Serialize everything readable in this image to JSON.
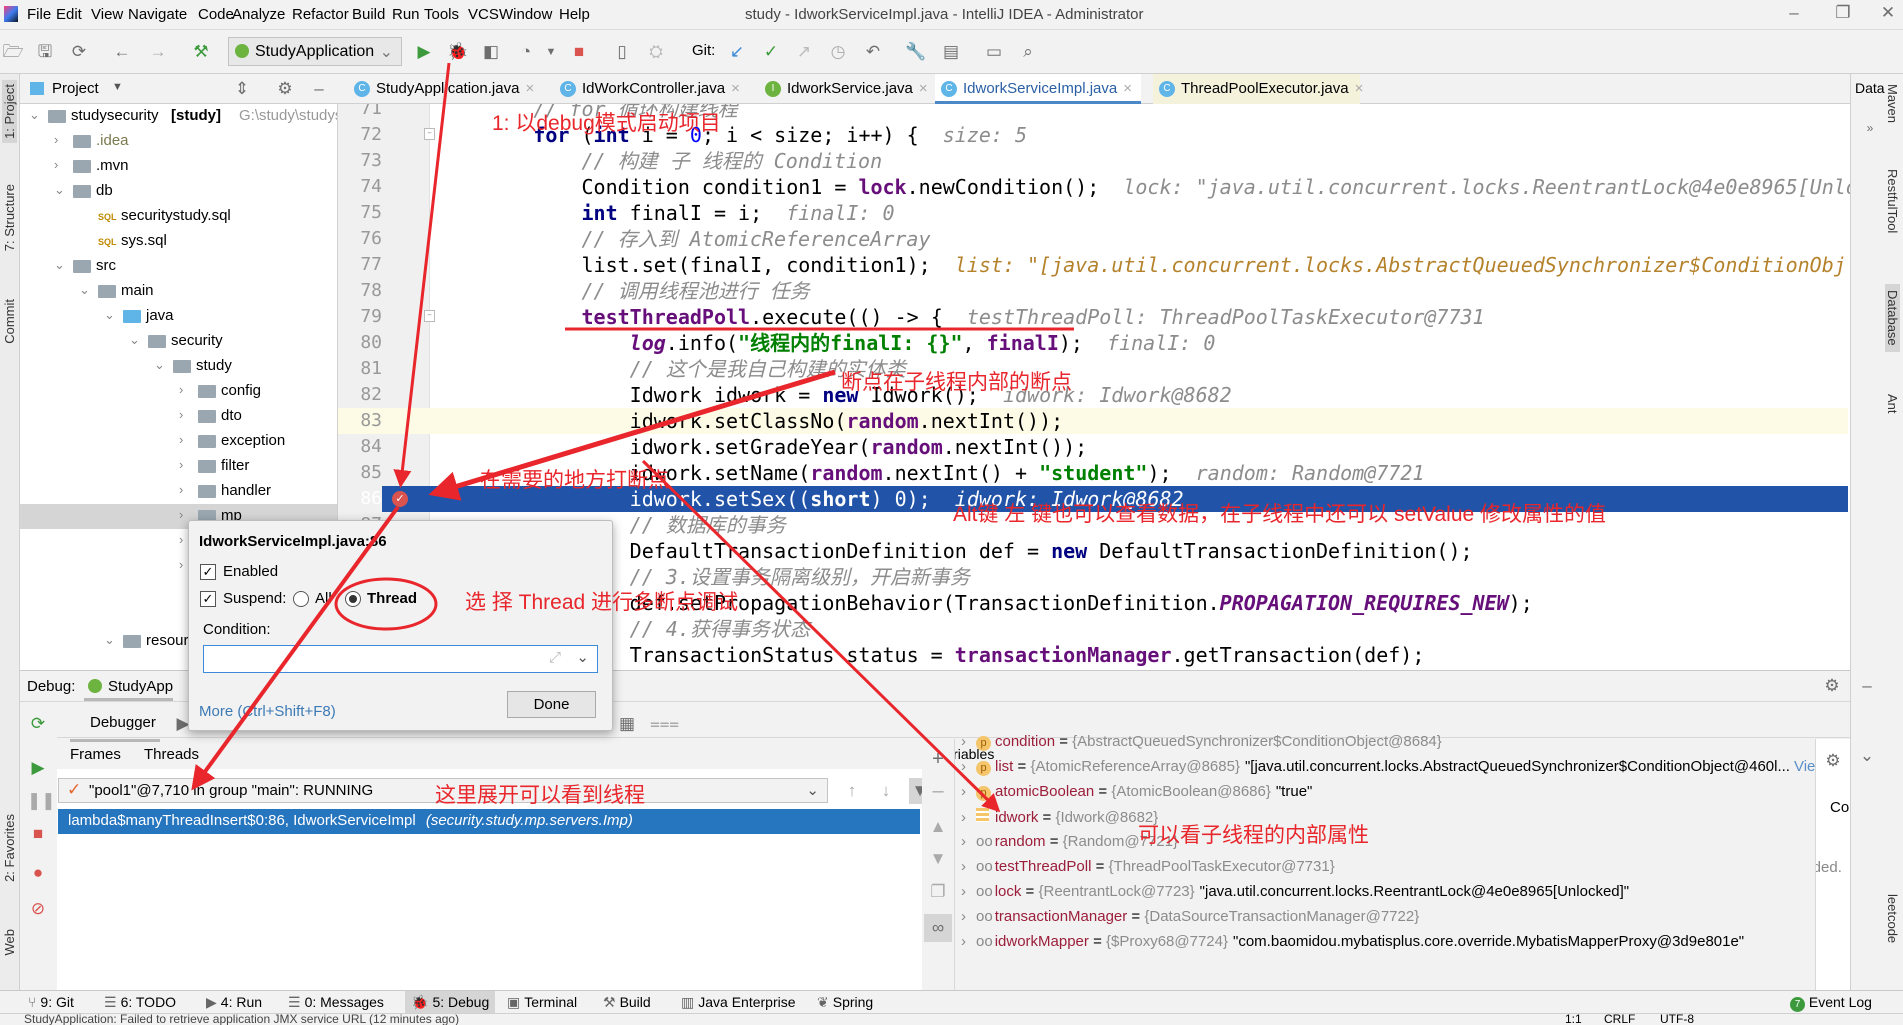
{
  "window": {
    "title": "study - IdworkServiceImpl.java - IntelliJ IDEA - Administrator",
    "menu": [
      "File",
      "Edit",
      "View",
      "Navigate",
      "Code",
      "Analyze",
      "Refactor",
      "Build",
      "Run",
      "Tools",
      "VCS",
      "Window",
      "Help"
    ]
  },
  "toolbar": {
    "run_config": "StudyApplication",
    "git_label": "Git:"
  },
  "left_strip": [
    "1: Project",
    "7: Structure",
    "Commit",
    "2: Favorites",
    "Web"
  ],
  "right_strip": [
    "Maven",
    "RestfulTool",
    "Database",
    "Ant"
  ],
  "right_panel_label": "Data",
  "project": {
    "header": "Project",
    "tree": [
      {
        "label": "studysecurity",
        "bold": "[study]",
        "path": "G:\\study\\studysec",
        "level": 0,
        "arrow": "down",
        "icon": "module"
      },
      {
        "label": ".idea",
        "level": 1,
        "arrow": "right",
        "icon": "folder"
      },
      {
        "label": ".mvn",
        "level": 1,
        "arrow": "right",
        "icon": "folder"
      },
      {
        "label": "db",
        "level": 1,
        "arrow": "down",
        "icon": "folder"
      },
      {
        "label": "securitystudy.sql",
        "level": 2,
        "arrow": "",
        "icon": "sql"
      },
      {
        "label": "sys.sql",
        "level": 2,
        "arrow": "",
        "icon": "sql"
      },
      {
        "label": "src",
        "level": 1,
        "arrow": "down",
        "icon": "folder"
      },
      {
        "label": "main",
        "level": 2,
        "arrow": "down",
        "icon": "folder"
      },
      {
        "label": "java",
        "level": 3,
        "arrow": "down",
        "icon": "java-folder"
      },
      {
        "label": "security",
        "level": 4,
        "arrow": "down",
        "icon": "package"
      },
      {
        "label": "study",
        "level": 5,
        "arrow": "down",
        "icon": "package"
      },
      {
        "label": "config",
        "level": 6,
        "arrow": "right",
        "icon": "package"
      },
      {
        "label": "dto",
        "level": 6,
        "arrow": "right",
        "icon": "package"
      },
      {
        "label": "exception",
        "level": 6,
        "arrow": "right",
        "icon": "package"
      },
      {
        "label": "filter",
        "level": 6,
        "arrow": "right",
        "icon": "package"
      },
      {
        "label": "handler",
        "level": 6,
        "arrow": "right",
        "icon": "package"
      },
      {
        "label": "mp",
        "level": 6,
        "arrow": "right",
        "icon": "package",
        "selected": true
      },
      {
        "label": "",
        "level": 6,
        "arrow": "right",
        "icon": ""
      },
      {
        "label": "",
        "level": 6,
        "arrow": "right",
        "icon": ""
      },
      {
        "label": "",
        "level": 6,
        "arrow": "",
        "icon": ""
      },
      {
        "label": "",
        "level": 6,
        "arrow": "",
        "icon": ""
      },
      {
        "label": "resour",
        "level": 3,
        "arrow": "down",
        "icon": "folder"
      }
    ]
  },
  "tabs": [
    {
      "label": "StudyApplication.java",
      "icon": "C"
    },
    {
      "label": "IdWorkController.java",
      "icon": "C"
    },
    {
      "label": "IdworkService.java",
      "icon": "I"
    },
    {
      "label": "IdworkServiceImpl.java",
      "icon": "C",
      "active": true
    },
    {
      "label": "ThreadPoolExecutor.java",
      "icon": "C"
    }
  ],
  "editor": {
    "current_line": 83,
    "selected_line": 86,
    "breakpoint_line": 86,
    "lines": [
      {
        "n": "71",
        "t": [
          [
            "p",
            "        "
          ],
          [
            "cm",
            "// for 循环构建线程"
          ]
        ]
      },
      {
        "n": "72",
        "t": [
          [
            "p",
            "        "
          ],
          [
            "kw",
            "for"
          ],
          [
            "p",
            " ("
          ],
          [
            "kw",
            "int"
          ],
          [
            "p",
            " i = "
          ],
          [
            "num",
            "0"
          ],
          [
            "p",
            "; i < size; i++) {"
          ],
          [
            "hint",
            "  size: 5"
          ]
        ]
      },
      {
        "n": "73",
        "t": [
          [
            "p",
            "            "
          ],
          [
            "cm",
            "// 构建 子 线程的 Condition"
          ]
        ]
      },
      {
        "n": "74",
        "t": [
          [
            "p",
            "            Condition condition1 = "
          ],
          [
            "fld",
            "lock"
          ],
          [
            "p",
            ".newCondition();"
          ],
          [
            "hint",
            "  lock: \"java.util.concurrent.locks.ReentrantLock@4e0e8965[Unlocked]\""
          ]
        ]
      },
      {
        "n": "75",
        "t": [
          [
            "p",
            "            "
          ],
          [
            "kw",
            "int"
          ],
          [
            "p",
            " finalI = i;"
          ],
          [
            "hint",
            "  finalI: 0"
          ]
        ]
      },
      {
        "n": "76",
        "t": [
          [
            "p",
            "            "
          ],
          [
            "cm",
            "// 存入到 AtomicReferenceArray"
          ]
        ]
      },
      {
        "n": "77",
        "t": [
          [
            "p",
            "            list.set(finalI, condition1);"
          ],
          [
            "hintstr",
            "  list: \"[java.util.concurrent.locks.AbstractQueuedSynchronizer$ConditionObj"
          ]
        ]
      },
      {
        "n": "78",
        "t": [
          [
            "p",
            "            "
          ],
          [
            "cm",
            "// 调用线程池进行 任务"
          ]
        ]
      },
      {
        "n": "79",
        "t": [
          [
            "p",
            "            "
          ],
          [
            "fld",
            "testThreadPoll"
          ],
          [
            "p",
            ".execute(() -> {"
          ],
          [
            "hint",
            "  testThreadPoll: ThreadPoolTaskExecutor@7731"
          ]
        ]
      },
      {
        "n": "80",
        "t": [
          [
            "p",
            "                "
          ],
          [
            "fldi",
            "log"
          ],
          [
            "p",
            ".info("
          ],
          [
            "str",
            "\"线程内的finalI: {}\""
          ],
          [
            "p",
            ", "
          ],
          [
            "fld",
            "finalI"
          ],
          [
            "p",
            ");"
          ],
          [
            "hint",
            "  finalI: 0"
          ]
        ]
      },
      {
        "n": "81",
        "t": [
          [
            "p",
            "                "
          ],
          [
            "cm",
            "// 这个是我自己构建的实体类"
          ]
        ]
      },
      {
        "n": "82",
        "t": [
          [
            "p",
            "                Idwork idwork = "
          ],
          [
            "kw",
            "new"
          ],
          [
            "p",
            " Idwork();"
          ],
          [
            "hint",
            "  idwork: Idwork@8682"
          ]
        ]
      },
      {
        "n": "83",
        "t": [
          [
            "p",
            "                idwork.setClassNo("
          ],
          [
            "fld",
            "random"
          ],
          [
            "p",
            ".nextInt());"
          ]
        ]
      },
      {
        "n": "84",
        "t": [
          [
            "p",
            "                idwork.setGradeYear("
          ],
          [
            "fld",
            "random"
          ],
          [
            "p",
            ".nextInt());"
          ]
        ]
      },
      {
        "n": "85",
        "t": [
          [
            "p",
            "                idwork.setName("
          ],
          [
            "fld",
            "random"
          ],
          [
            "p",
            ".nextInt() + "
          ],
          [
            "str",
            "\"student\""
          ],
          [
            "p",
            ");"
          ],
          [
            "hint",
            "  random: Random@7721"
          ]
        ]
      },
      {
        "n": "86",
        "t": [
          [
            "p",
            "                idwork.setSex(("
          ],
          [
            "kw",
            "short"
          ],
          [
            "p",
            ") 0);"
          ],
          [
            "hint",
            "  idwork: Idwork@8682"
          ]
        ]
      },
      {
        "n": "87",
        "t": [
          [
            "p",
            "                "
          ],
          [
            "cm",
            "// 数据库的事务"
          ]
        ]
      },
      {
        "n": "88",
        "t": [
          [
            "p",
            "                DefaultTransactionDefinition def = "
          ],
          [
            "kw",
            "new"
          ],
          [
            "p",
            " DefaultTransactionDefinition();"
          ]
        ]
      },
      {
        "n": "89",
        "t": [
          [
            "p",
            "                "
          ],
          [
            "cm",
            "// 3.设置事务隔离级别，开启新事务"
          ]
        ]
      },
      {
        "n": "90",
        "t": [
          [
            "p",
            "                def.setPropagationBehavior(TransactionDefinition."
          ],
          [
            "const",
            "PROPAGATION_REQUIRES_NEW"
          ],
          [
            "p",
            ");"
          ]
        ]
      },
      {
        "n": "91",
        "t": [
          [
            "p",
            "                "
          ],
          [
            "cm",
            "// 4.获得事务状态"
          ]
        ]
      },
      {
        "n": "92",
        "t": [
          [
            "p",
            "                TransactionStatus status = "
          ],
          [
            "fld",
            "transactionManager"
          ],
          [
            "p",
            ".getTransaction(def);"
          ]
        ]
      }
    ]
  },
  "breakpoint_popup": {
    "title": "IdworkServiceImpl.java:86",
    "enabled_label": "Enabled",
    "enabled": true,
    "suspend_label": "Suspend:",
    "suspend": true,
    "option_all": "All",
    "option_thread": "Thread",
    "selected_option": "Thread",
    "condition_label": "Condition:",
    "condition_value": "",
    "more_link": "More (Ctrl+Shift+F8)",
    "done_button": "Done"
  },
  "debug": {
    "label": "Debug:",
    "session_tab": "StudyApp",
    "debugger_tab": "Debugger",
    "frames_tab": "Frames",
    "threads_tab": "Threads",
    "thread_selected": "\"pool1\"@7,710 in group \"main\": RUNNING",
    "frame_method": "lambda$manyThreadInsert$0:86, IdworkServiceImpl",
    "frame_package": "(security.study.mp.servers.Imp)",
    "variables_header": "Variables",
    "variables": [
      {
        "icon": "p",
        "name": "condition",
        "value": "{AbstractQueuedSynchronizer$ConditionObject@8684}",
        "str": ""
      },
      {
        "icon": "p",
        "name": "list",
        "value": "{AtomicReferenceArray@8685}",
        "str": "\"[java.util.concurrent.locks.AbstractQueuedSynchronizer$ConditionObject@460l...",
        "link": "View"
      },
      {
        "icon": "p",
        "name": "atomicBoolean",
        "value": "{AtomicBoolean@8686}",
        "str": "\"true\""
      },
      {
        "icon": "field",
        "name": "idwork",
        "value": "{Idwork@8682}",
        "str": ""
      },
      {
        "icon": "oo",
        "name": "random",
        "value": "{Random@7721}",
        "str": ""
      },
      {
        "icon": "oo",
        "name": "testThreadPoll",
        "value": "{ThreadPoolTaskExecutor@7731}",
        "str": ""
      },
      {
        "icon": "oo",
        "name": "lock",
        "value": "{ReentrantLock@7723}",
        "str": "\"java.util.concurrent.locks.ReentrantLock@4e0e8965[Unlocked]\""
      },
      {
        "icon": "oo",
        "name": "transactionManager",
        "value": "{DataSourceTransactionManager@7722}",
        "str": ""
      },
      {
        "icon": "oo",
        "name": "idworkMapper",
        "value": "{$Proxy68@7724}",
        "str": "\"com.baomidou.mybatisplus.core.override.MybatisMapperProxy@3d9e801e\""
      }
    ],
    "side_panel_text": "Cou",
    "side_panel_text2": "oaded. I"
  },
  "bottom_tools": [
    {
      "label": "9: Git",
      "icon": "git-icon"
    },
    {
      "label": "6: TODO",
      "icon": "todo-icon"
    },
    {
      "label": "4: Run",
      "icon": "run-icon"
    },
    {
      "label": "0: Messages",
      "icon": "messages-icon"
    },
    {
      "label": "5: Debug",
      "icon": "debug-icon",
      "active": true
    },
    {
      "label": "Terminal",
      "icon": "terminal-icon"
    },
    {
      "label": "Build",
      "icon": "build-icon"
    },
    {
      "label": "Java Enterprise",
      "icon": "java-enterprise-icon"
    },
    {
      "label": "Spring",
      "icon": "spring-icon"
    }
  ],
  "event_log": {
    "label": "Event Log",
    "count": "7"
  },
  "status": {
    "message": "StudyApplication: Failed to retrieve application JMX service URL (12 minutes ago)",
    "position": "1:1",
    "line_sep": "CRLF",
    "encoding": "UTF-8"
  },
  "annotations": {
    "step1": "1: 以debug模式启动项目",
    "inner_breakpoint": "断点在子线程内部的断点",
    "set_breakpoint": "在需要的地方打断点",
    "alt_click": "Alt键 左 键也可以查看数据，在子线程中还可以 setValue 修改属性的值",
    "choose_thread": "选 择 Thread 进行多断点调试",
    "expand_threads": "这里展开可以看到线程",
    "inner_props": "可以看子线程的内部属性",
    "color": "#e8262b"
  },
  "colors": {
    "selection": "#2154a8",
    "frame_selection": "#2675bf",
    "current_line": "#fdfbe6"
  }
}
